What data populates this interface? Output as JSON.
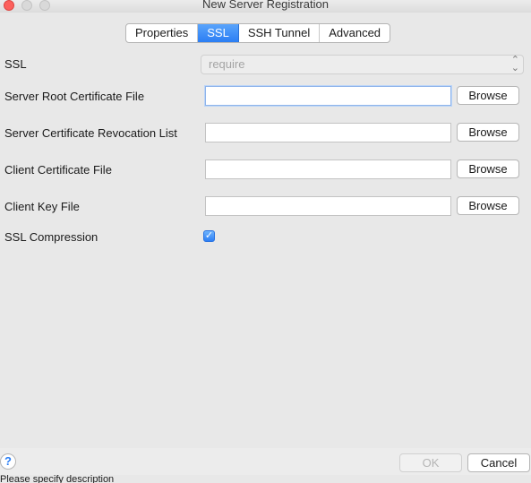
{
  "window": {
    "title": "New Server Registration"
  },
  "tabs": [
    {
      "label": "Properties",
      "active": false
    },
    {
      "label": "SSL",
      "active": true
    },
    {
      "label": "SSH Tunnel",
      "active": false
    },
    {
      "label": "Advanced",
      "active": false
    }
  ],
  "form": {
    "ssl": {
      "label": "SSL",
      "value": "require"
    },
    "root_cert": {
      "label": "Server Root Certificate File",
      "value": "",
      "browse_label": "Browse"
    },
    "revocation_list": {
      "label": "Server Certificate Revocation List",
      "value": "",
      "browse_label": "Browse"
    },
    "client_cert": {
      "label": "Client Certificate File",
      "value": "",
      "browse_label": "Browse"
    },
    "client_key": {
      "label": "Client Key File",
      "value": "",
      "browse_label": "Browse"
    },
    "compression": {
      "label": "SSL Compression",
      "checked": true
    }
  },
  "footer": {
    "help_label": "?",
    "ok_label": "OK",
    "cancel_label": "Cancel"
  },
  "status": {
    "text": "Please specify description"
  },
  "colors": {
    "accent": "#2b7ef4",
    "close": "#fc605c"
  }
}
